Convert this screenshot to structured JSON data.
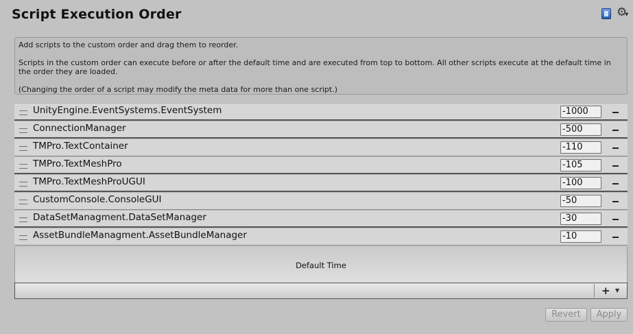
{
  "window": {
    "title": "Script Execution Order"
  },
  "info": {
    "line1": "Add scripts to the custom order and drag them to reorder.",
    "line2": "Scripts in the custom order can execute before or after the default time and are executed from top to bottom. All other scripts execute at the default time in the order they are loaded.",
    "line3": "(Changing the order of a script may modify the meta data for more than one script.)"
  },
  "scripts": [
    {
      "name": "UnityEngine.EventSystems.EventSystem",
      "order": "-1000"
    },
    {
      "name": "ConnectionManager",
      "order": "-500"
    },
    {
      "name": "TMPro.TextContainer",
      "order": "-110"
    },
    {
      "name": "TMPro.TextMeshPro",
      "order": "-105"
    },
    {
      "name": "TMPro.TextMeshProUGUI",
      "order": "-100"
    },
    {
      "name": "CustomConsole.ConsoleGUI",
      "order": "-50"
    },
    {
      "name": "DataSetManagment.DataSetManager",
      "order": "-30"
    },
    {
      "name": "AssetBundleManagment.AssetBundleManager",
      "order": "-10"
    }
  ],
  "list": {
    "default_time_label": "Default Time"
  },
  "buttons": {
    "revert": "Revert",
    "apply": "Apply"
  },
  "icons": {
    "help": "help-book-icon",
    "settings": "gear-icon",
    "add": "plus-icon",
    "remove": "minus-icon",
    "drag": "drag-handle-icon"
  }
}
